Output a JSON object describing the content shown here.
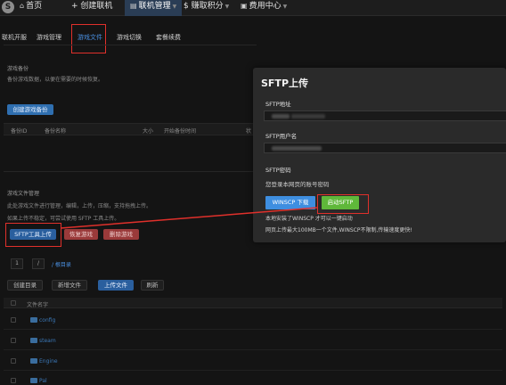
{
  "nav": {
    "logo": "S",
    "home": "首页",
    "create": "+ 创建联机",
    "manage": "联机管理",
    "points": "$ 赚取积分",
    "user": "费用中心"
  },
  "tabs": [
    "联机开服",
    "游戏管理",
    "游戏文件",
    "游戏切换",
    "套餐续费"
  ],
  "backup": {
    "title": "游戏备份",
    "desc": "备份游戏数据，以便在需要的时候恢复。",
    "create_btn": "创建游戏备份",
    "headers": [
      "备份ID",
      "备份名称",
      "大小",
      "开始备份时间",
      "状"
    ]
  },
  "files": {
    "title": "游戏文件管理",
    "desc1": "此处游戏文件进行管理，编辑，上传，压缩，支持拖拽上传。",
    "desc2": "如果上传不稳定，可尝试使用 SFTP 工具上传。",
    "sftp_btn": "SFTP工具上传",
    "restore_btn": "恢复游戏",
    "delete_btn": "删除游戏",
    "page_1": "1",
    "page_2": "/",
    "root_link": "/ 根目录",
    "create_dir": "创建目录",
    "new_file": "新增文件",
    "upload_file": "上传文件",
    "refresh": "刷新",
    "col_name": "文件名字",
    "rows": [
      "config",
      "steam",
      "Engine",
      "Pal"
    ]
  },
  "sftp": {
    "title": "SFTP上传",
    "addr_label": "SFTP地址",
    "user_label": "SFTP用户名",
    "pass_label": "SFTP密码",
    "pass_note": "您登录本网页的账号密码",
    "winscp_btn": "WINSCP 下载",
    "start_btn": "启动SFTP",
    "note1": "本地安装了WINSCP 才可以一键启动",
    "note2": "网页上传最大100MB一个文件,WINSCP不限制,传输速度更快!"
  },
  "colors": {
    "accent": "#4a90e2",
    "highlight": "#e0302b",
    "start_button": "#5fb83a"
  }
}
